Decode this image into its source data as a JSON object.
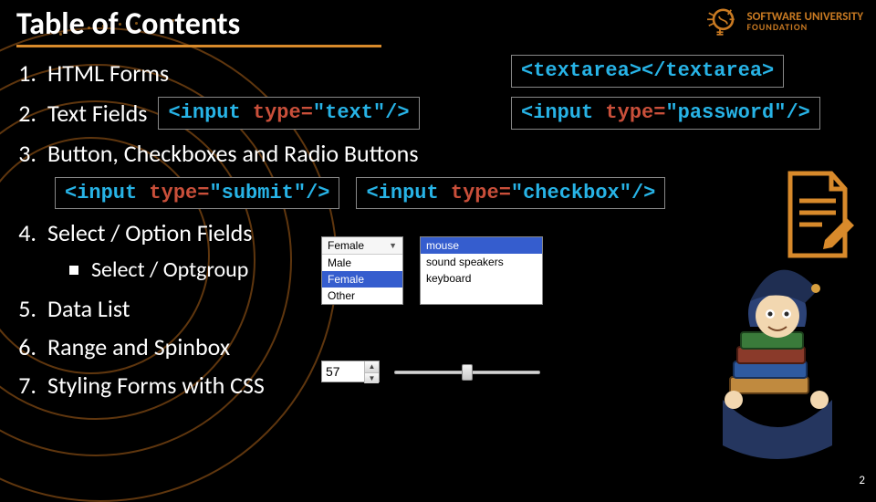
{
  "title": "Table of Contents",
  "logo": {
    "line1": "SOFTWARE UNIVERSITY",
    "line2": "FOUNDATION"
  },
  "toc": {
    "item1": {
      "num": "1.",
      "text": "HTML Forms"
    },
    "item2": {
      "num": "2.",
      "text": "Text Fields"
    },
    "item3": {
      "num": "3.",
      "text": "Button, Checkboxes and Radio Buttons"
    },
    "item4": {
      "num": "4.",
      "text": "Select / Option Fields"
    },
    "item4sub": "Select / Optgroup",
    "item5": {
      "num": "5.",
      "text": "Data List"
    },
    "item6": {
      "num": "6.",
      "text": "Range and Spinbox"
    },
    "item7": {
      "num": "7.",
      "text": "Styling Forms with CSS"
    }
  },
  "code": {
    "textarea_open": "<textarea>",
    "textarea_close": "</textarea>",
    "input_text_pre": "<input ",
    "input_text_mid": "type=",
    "input_text_val": "\"text\"",
    "input_text_post": "/>",
    "input_password_val": "\"password\"",
    "input_submit_val": "\"submit\"",
    "input_checkbox_val": "\"checkbox\""
  },
  "select1": {
    "current": "Female",
    "opts": [
      "Male",
      "Female",
      "Other"
    ]
  },
  "select2": {
    "opts": [
      "mouse",
      "sound speakers",
      "keyboard"
    ],
    "highlight": 0
  },
  "spin_value": "57",
  "page_number": "2"
}
